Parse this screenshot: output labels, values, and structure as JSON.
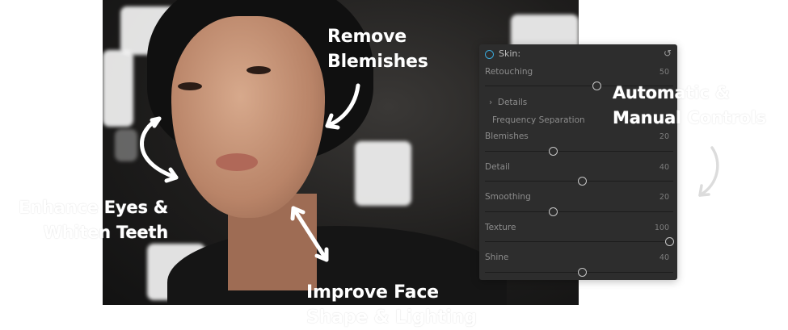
{
  "callouts": {
    "remove_blemishes": [
      "Remove",
      "Blemishes"
    ],
    "automatic_controls": [
      "Automatic &",
      "Manual Controls"
    ],
    "enhance_eyes": [
      "Enhance Eyes &",
      "Whiten Teeth"
    ],
    "improve_face": [
      "Improve Face",
      "Shape & Lighting"
    ]
  },
  "panel": {
    "title": "Skin:",
    "details_label": "Details",
    "frequency_label": "Frequency Separation",
    "sliders": [
      {
        "label": "Retouching",
        "value": "50",
        "level": 0.5
      },
      {
        "label": "Blemishes",
        "value": "20",
        "level": 0.2
      },
      {
        "label": "Detail",
        "value": "40",
        "level": 0.4
      },
      {
        "label": "Smoothing",
        "value": "20",
        "level": 0.2
      },
      {
        "label": "Texture",
        "value": "100",
        "level": 1.0
      },
      {
        "label": "Shine",
        "value": "40",
        "level": 0.4
      }
    ]
  },
  "colors": {
    "accent": "#3aa7d9",
    "panel_bg": "#2d2d2d"
  },
  "icons": {
    "skin": "circle-ring-icon",
    "reset": "undo-icon",
    "expand": "chevron-right-icon"
  }
}
